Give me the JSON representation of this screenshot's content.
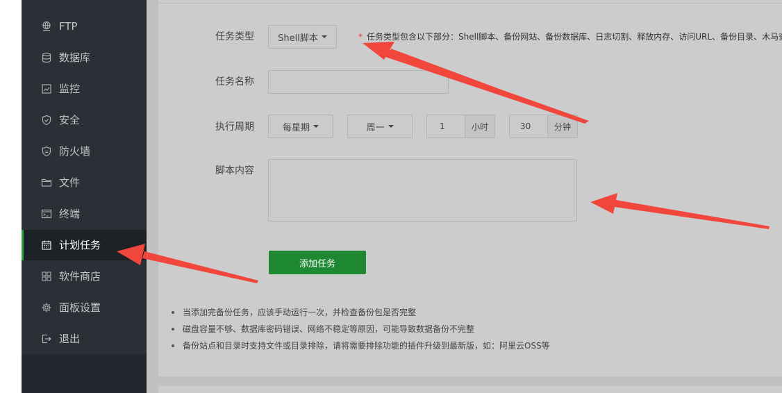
{
  "sidebar": {
    "items": [
      {
        "label": "FTP",
        "icon": "globe-icon"
      },
      {
        "label": "数据库",
        "icon": "database-icon"
      },
      {
        "label": "监控",
        "icon": "monitor-chart-icon"
      },
      {
        "label": "安全",
        "icon": "shield-icon"
      },
      {
        "label": "防火墙",
        "icon": "firewall-shield-icon"
      },
      {
        "label": "文件",
        "icon": "folder-icon"
      },
      {
        "label": "终端",
        "icon": "terminal-icon"
      },
      {
        "label": "计划任务",
        "icon": "calendar-icon"
      },
      {
        "label": "软件商店",
        "icon": "grid-apps-icon"
      },
      {
        "label": "面板设置",
        "icon": "gear-icon"
      },
      {
        "label": "退出",
        "icon": "logout-icon"
      }
    ],
    "active_index": 7
  },
  "form": {
    "task_type_label": "任务类型",
    "task_type_value": "Shell脚本",
    "task_type_hint_star": "*",
    "task_type_hint": "任务类型包含以下部分：Shell脚本、备份网站、备份数据库、日志切割、释放内存、访问URL、备份目录、木马查",
    "task_name_label": "任务名称",
    "task_name_value": "",
    "period_label": "执行周期",
    "period_type": "每星期",
    "period_day": "周一",
    "hour_value": "1",
    "hour_unit": "小时",
    "minute_value": "30",
    "minute_unit": "分钟",
    "script_label": "脚本内容",
    "script_value": "",
    "submit_label": "添加任务"
  },
  "notes": [
    "当添加完备份任务，应该手动运行一次，并检查备份包是否完整",
    "磁盘容量不够、数据库密码错误、网络不稳定等原因，可能导致数据备份不完整",
    "备份站点和目录时支持文件或目录排除，请将需要排除功能的插件升级到最新版，如：阿里云OSS等"
  ],
  "colors": {
    "sidebar_bg": "#2a3036",
    "active_accent": "#20a53a",
    "submit_bg": "#1e8932",
    "annotation_arrow": "#f0463c"
  }
}
